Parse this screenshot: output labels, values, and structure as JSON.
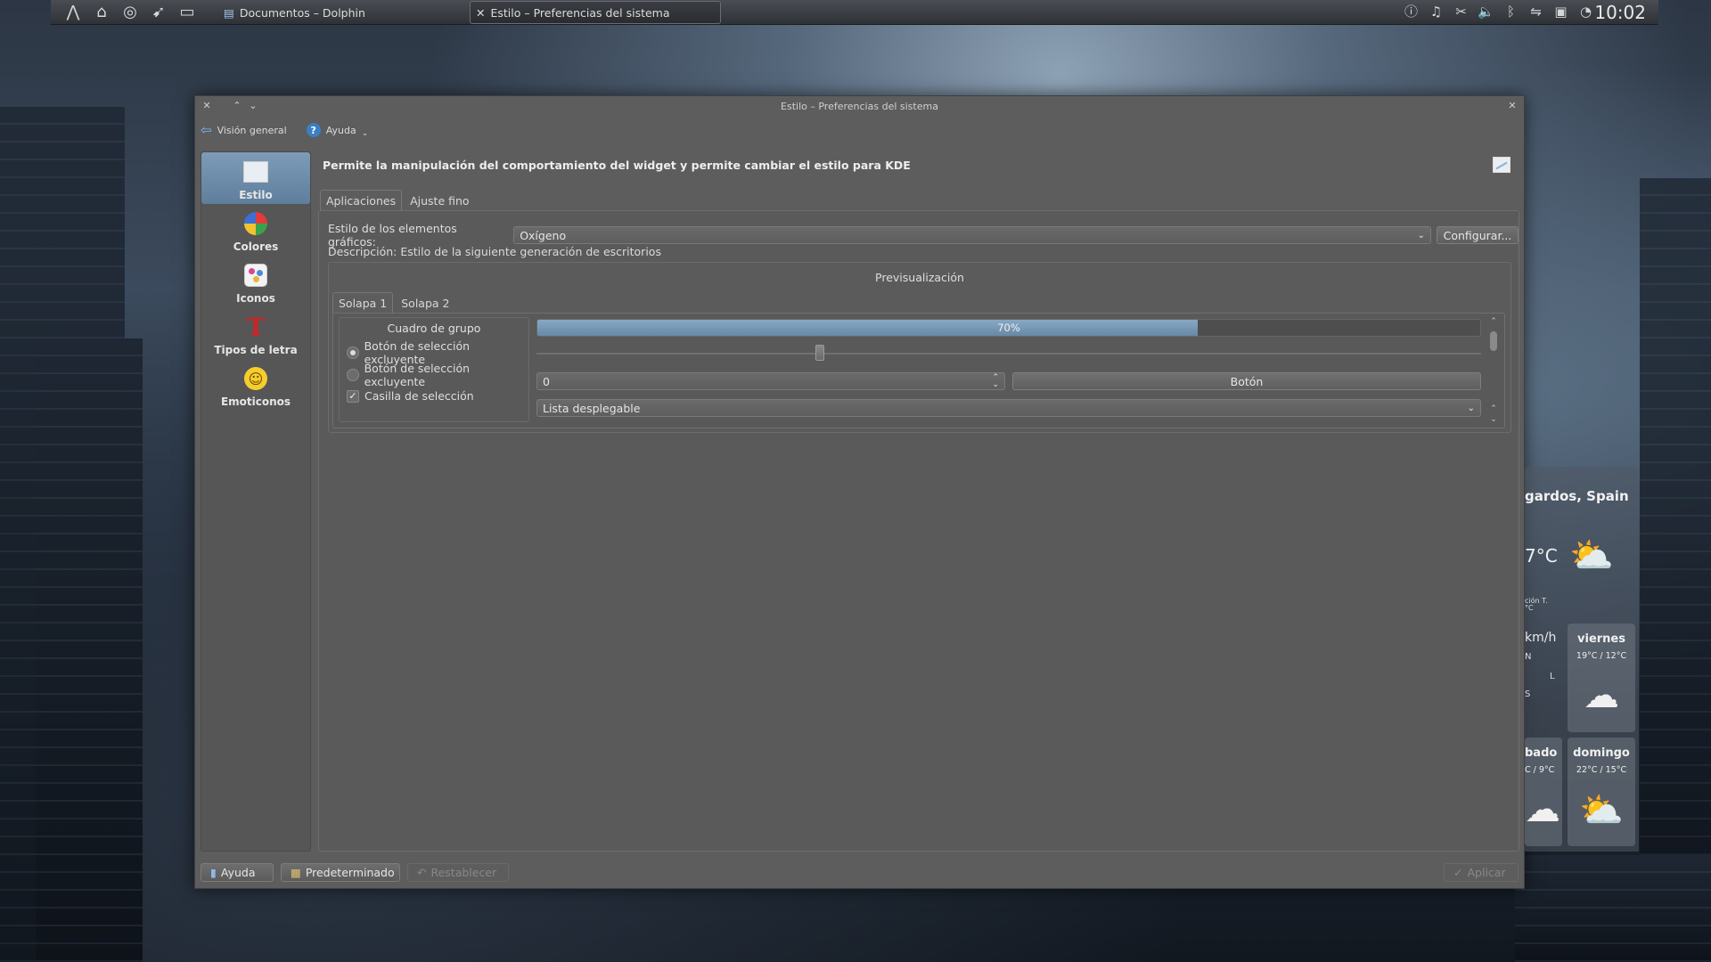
{
  "taskbar": {
    "tasks": [
      {
        "label": "Documentos – Dolphin"
      },
      {
        "label": "Estilo – Preferencias del sistema"
      }
    ],
    "clock": "10:02"
  },
  "window": {
    "title": "Estilo – Preferencias del sistema",
    "toolbar": {
      "overview": "Visión general",
      "help": "Ayuda"
    },
    "sidebar": [
      {
        "label": "Estilo",
        "icon": "style-icon"
      },
      {
        "label": "Colores",
        "icon": "colors-icon"
      },
      {
        "label": "Iconos",
        "icon": "icons-icon"
      },
      {
        "label": "Tipos de letra",
        "icon": "fonts-icon"
      },
      {
        "label": "Emoticonos",
        "icon": "emoticons-icon"
      }
    ],
    "header": "Permite la manipulación del comportamiento del widget y permite cambiar el estilo para KDE",
    "tabs": [
      "Aplicaciones",
      "Ajuste fino"
    ],
    "widget_style_label": "Estilo de los elementos gráficos:",
    "widget_style_value": "Oxígeno",
    "configure_button": "Configurar...",
    "description": "Descripción: Estilo de la siguiente generación de escritorios",
    "preview": {
      "title": "Previsualización",
      "tabs": [
        "Solapa 1",
        "Solapa 2"
      ],
      "group_title": "Cuadro de grupo",
      "radio1": "Botón de selección excluyente",
      "radio2": "Botón de selección excluyente",
      "checkbox": "Casilla de selección",
      "progress_label": "70%",
      "progress_value": 0.7,
      "slider_value": 0.3,
      "spin_value": "0",
      "button": "Botón",
      "combo": "Lista desplegable"
    },
    "bottom": {
      "help": "Ayuda",
      "defaults": "Predeterminado",
      "reset": "Restablecer",
      "apply": "Aplicar"
    }
  },
  "weather": {
    "location": "gardos, Spain",
    "temp": "7°C",
    "small1": "ción T.",
    "small2": "°C",
    "wind": "km/h",
    "dir_n": "N",
    "dir_l": "L",
    "dir_s": "S",
    "days": [
      {
        "day": "viernes",
        "range": "19°C / 12°C"
      },
      {
        "day": "bado",
        "range": "C / 9°C"
      },
      {
        "day": "domingo",
        "range": "22°C / 15°C"
      }
    ]
  }
}
